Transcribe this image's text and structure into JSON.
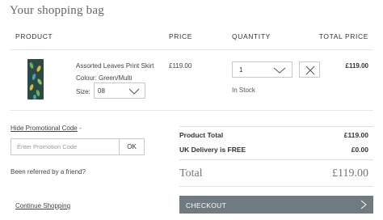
{
  "page": {
    "title": "Your shopping bag"
  },
  "columns": {
    "product": "PRODUCT",
    "price": "PRICE",
    "quantity": "QUANTITY",
    "total": "TOTAL PRICE"
  },
  "item": {
    "name": "Assorted Leaves Print Skirt",
    "colour": "Colour: Green/Multi",
    "size_label": "Size:",
    "size_value": "08",
    "price": "£119.00",
    "quantity": "1",
    "stock": "In Stock",
    "line_total": "£119.00"
  },
  "promo": {
    "toggle_link": "Hide Promotional Code",
    "toggle_suffix": " -",
    "placeholder": "Enter Promotion Code",
    "ok_label": "OK"
  },
  "referral": "Been referred by a friend?",
  "continue": "Continue Shopping",
  "summary": {
    "product_total_label": "Product Total",
    "product_total_value": "£119.00",
    "delivery_label": "UK Delivery is FREE",
    "delivery_value": "£0.00",
    "total_label": "Total",
    "total_value": "£119.00"
  },
  "checkout": {
    "label": "CHECKOUT"
  },
  "icons": {
    "size_dropdown": "chevron-down-icon",
    "qty_dropdown": "chevron-down-icon",
    "remove": "close-icon",
    "checkout_arrow": "chevron-right-icon"
  },
  "colors": {
    "checkout_bg": "#6f7b80",
    "product_swatch": "#2c4a45"
  }
}
